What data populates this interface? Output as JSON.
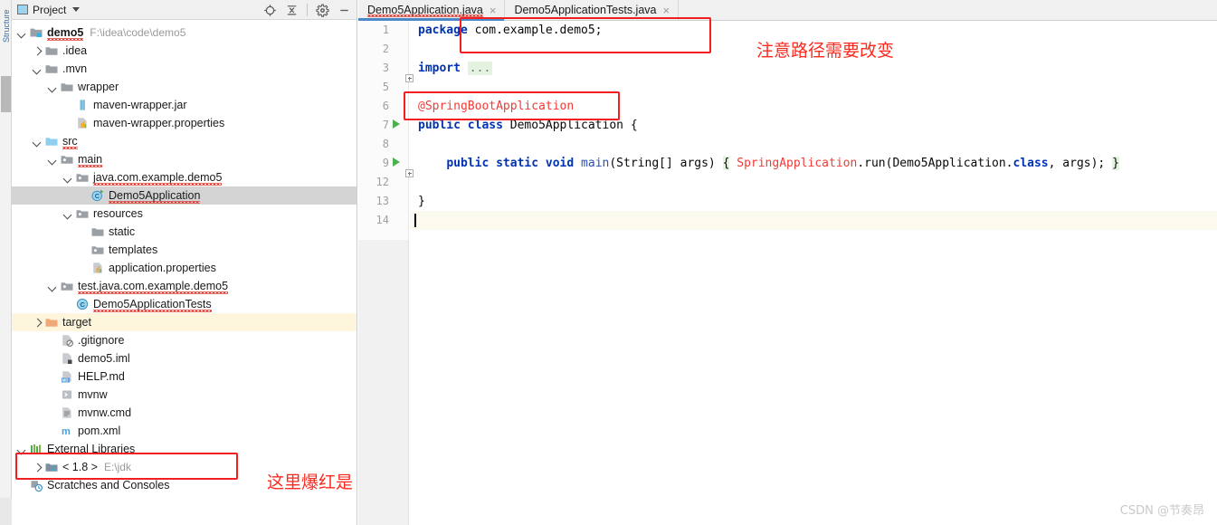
{
  "panel": {
    "title": "Project",
    "icons": [
      {
        "name": "locate-icon",
        "label": "Select Opened File"
      },
      {
        "name": "collapse-all-icon",
        "label": "Collapse All"
      },
      {
        "name": "gear-icon",
        "label": "Settings"
      },
      {
        "name": "minimize-icon",
        "label": "Hide"
      }
    ]
  },
  "tree": [
    {
      "label": "demo5",
      "sub": "F:\\idea\\code\\demo5",
      "indent": 0,
      "arrow": "down",
      "icon": "module-folder-icon",
      "bold": true,
      "squiggle": true,
      "state": "normal"
    },
    {
      "label": ".idea",
      "sub": "",
      "indent": 1,
      "arrow": "right",
      "icon": "folder-icon",
      "bold": false,
      "squiggle": false,
      "state": "normal"
    },
    {
      "label": ".mvn",
      "sub": "",
      "indent": 1,
      "arrow": "down",
      "icon": "folder-icon",
      "bold": false,
      "squiggle": false,
      "state": "normal"
    },
    {
      "label": "wrapper",
      "sub": "",
      "indent": 2,
      "arrow": "down",
      "icon": "folder-icon",
      "bold": false,
      "squiggle": false,
      "state": "normal"
    },
    {
      "label": "maven-wrapper.jar",
      "sub": "",
      "indent": 3,
      "arrow": "none",
      "icon": "jar-icon",
      "bold": false,
      "squiggle": false,
      "state": "normal"
    },
    {
      "label": "maven-wrapper.properties",
      "sub": "",
      "indent": 3,
      "arrow": "none",
      "icon": "properties-icon",
      "bold": false,
      "squiggle": false,
      "state": "normal"
    },
    {
      "label": "src",
      "sub": "",
      "indent": 1,
      "arrow": "down",
      "icon": "src-folder-icon",
      "bold": false,
      "squiggle": true,
      "state": "normal"
    },
    {
      "label": "main",
      "sub": "",
      "indent": 2,
      "arrow": "down",
      "icon": "source-root-icon",
      "bold": false,
      "squiggle": true,
      "state": "normal"
    },
    {
      "label": "java.com.example.demo5",
      "sub": "",
      "indent": 3,
      "arrow": "down",
      "icon": "source-root-icon",
      "bold": false,
      "squiggle": true,
      "state": "normal"
    },
    {
      "label": "Demo5Application",
      "sub": "",
      "indent": 4,
      "arrow": "none",
      "icon": "java-class-run-icon",
      "bold": false,
      "squiggle": true,
      "state": "selected"
    },
    {
      "label": "resources",
      "sub": "",
      "indent": 3,
      "arrow": "down",
      "icon": "resource-root-icon",
      "bold": false,
      "squiggle": false,
      "state": "normal"
    },
    {
      "label": "static",
      "sub": "",
      "indent": 4,
      "arrow": "none",
      "icon": "folder-icon",
      "bold": false,
      "squiggle": false,
      "state": "normal"
    },
    {
      "label": "templates",
      "sub": "",
      "indent": 4,
      "arrow": "none",
      "icon": "resource-root-icon",
      "bold": false,
      "squiggle": false,
      "state": "normal"
    },
    {
      "label": "application.properties",
      "sub": "",
      "indent": 4,
      "arrow": "none",
      "icon": "properties-icon",
      "bold": false,
      "squiggle": false,
      "state": "normal"
    },
    {
      "label": "test.java.com.example.demo5",
      "sub": "",
      "indent": 2,
      "arrow": "down",
      "icon": "test-root-icon",
      "bold": false,
      "squiggle": true,
      "state": "normal"
    },
    {
      "label": "Demo5ApplicationTests",
      "sub": "",
      "indent": 3,
      "arrow": "none",
      "icon": "java-class-icon",
      "bold": false,
      "squiggle": true,
      "state": "normal"
    },
    {
      "label": "target",
      "sub": "",
      "indent": 1,
      "arrow": "right",
      "icon": "excluded-folder-icon",
      "bold": false,
      "squiggle": false,
      "state": "highlight"
    },
    {
      "label": ".gitignore",
      "sub": "",
      "indent": 2,
      "arrow": "none",
      "icon": "gitignore-icon",
      "bold": false,
      "squiggle": false,
      "state": "normal"
    },
    {
      "label": "demo5.iml",
      "sub": "",
      "indent": 2,
      "arrow": "none",
      "icon": "iml-icon",
      "bold": false,
      "squiggle": false,
      "state": "normal"
    },
    {
      "label": "HELP.md",
      "sub": "",
      "indent": 2,
      "arrow": "none",
      "icon": "markdown-icon",
      "bold": false,
      "squiggle": false,
      "state": "normal"
    },
    {
      "label": "mvnw",
      "sub": "",
      "indent": 2,
      "arrow": "none",
      "icon": "shell-script-icon",
      "bold": false,
      "squiggle": false,
      "state": "normal"
    },
    {
      "label": "mvnw.cmd",
      "sub": "",
      "indent": 2,
      "arrow": "none",
      "icon": "cmd-script-icon",
      "bold": false,
      "squiggle": false,
      "state": "normal"
    },
    {
      "label": "pom.xml",
      "sub": "",
      "indent": 2,
      "arrow": "none",
      "icon": "maven-icon",
      "bold": false,
      "squiggle": false,
      "state": "normal"
    },
    {
      "label": "External Libraries",
      "sub": "",
      "indent": 0,
      "arrow": "down",
      "icon": "libraries-icon",
      "bold": false,
      "squiggle": false,
      "state": "normal"
    },
    {
      "label": "< 1.8 >",
      "sub": "E:\\jdk",
      "indent": 1,
      "arrow": "right",
      "icon": "jdk-icon",
      "bold": false,
      "squiggle": false,
      "state": "normal"
    },
    {
      "label": "Scratches and Consoles",
      "sub": "",
      "indent": 0,
      "arrow": "none",
      "icon": "scratches-icon",
      "bold": false,
      "squiggle": false,
      "state": "normal"
    }
  ],
  "editor": {
    "tabs": [
      {
        "label": "Demo5Application.java",
        "active": true,
        "close": "×"
      },
      {
        "label": "Demo5ApplicationTests.java",
        "active": false,
        "close": "×"
      }
    ],
    "lines": [
      {
        "num": "1",
        "run": false,
        "fold": "none"
      },
      {
        "num": "2",
        "run": false,
        "fold": "none"
      },
      {
        "num": "3",
        "run": false,
        "fold": "plus"
      },
      {
        "num": "5",
        "run": false,
        "fold": "none"
      },
      {
        "num": "6",
        "run": false,
        "fold": "none"
      },
      {
        "num": "7",
        "run": true,
        "fold": "none"
      },
      {
        "num": "8",
        "run": false,
        "fold": "none"
      },
      {
        "num": "9",
        "run": true,
        "fold": "plus"
      },
      {
        "num": "12",
        "run": false,
        "fold": "none"
      },
      {
        "num": "13",
        "run": false,
        "fold": "none"
      },
      {
        "num": "14",
        "run": false,
        "fold": "none"
      }
    ],
    "code": {
      "l1_kw": "package",
      "l1_pkg": " com.example.demo5;",
      "l3_kw": "import",
      "l3_ellipsis": "...",
      "l6_annotation": "@SpringBootApplication",
      "l7_public": "public",
      "l7_class": "class",
      "l7_name": "Demo5Application",
      "l7_brace": "{",
      "l9_public": "public",
      "l9_static": "static",
      "l9_void": "void",
      "l9_main": "main",
      "l9_params": "(String[] args)",
      "l9_open": "{",
      "l9_springapp": "SpringApplication",
      "l9_run": ".run(Demo5Application.",
      "l9_classkw": "class",
      "l9_args": ", args);",
      "l9_close": "}",
      "l13_brace": "}"
    }
  },
  "annotations": {
    "note_package": "注意路径需要改变",
    "note_jdk": "这里爆红是",
    "box_color": "#f11f1f"
  },
  "watermark": "CSDN @节奏昂",
  "colors": {
    "keyword": "#0033b3",
    "annotation": "#ef3b36",
    "method": "#2c4fb8",
    "selection": "#d4d4d4",
    "tab_active_underline": "#4a88c7",
    "note_red": "#fb2a1e"
  }
}
